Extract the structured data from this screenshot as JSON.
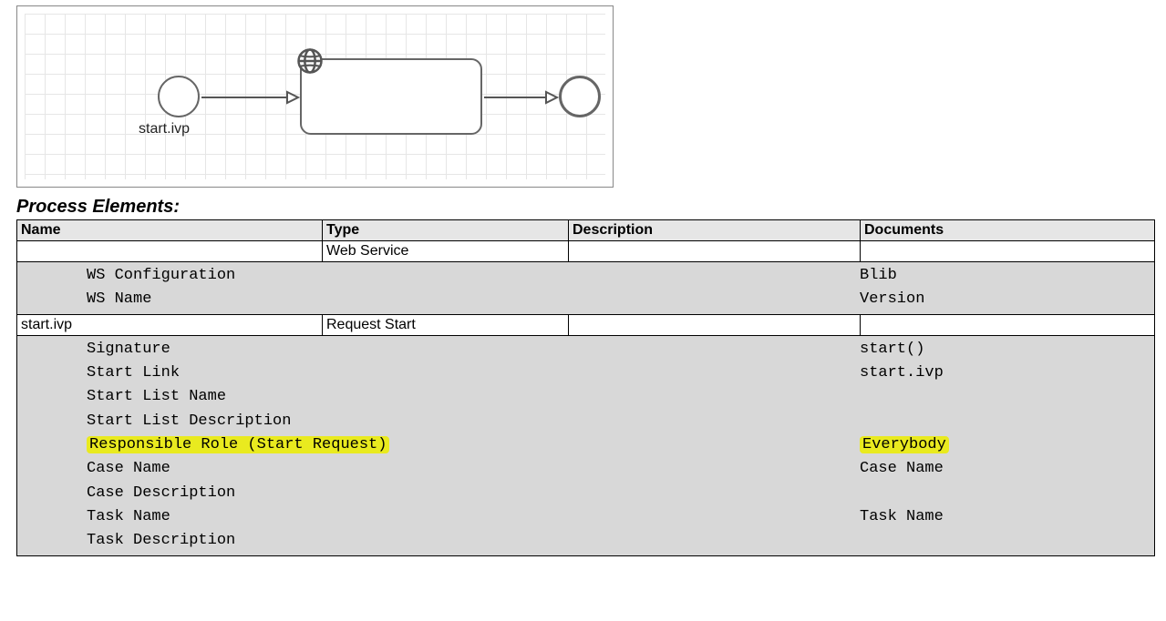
{
  "diagram": {
    "start_label": "start.ivp"
  },
  "heading": "Process Elements:",
  "table": {
    "headers": {
      "name": "Name",
      "type": "Type",
      "description": "Description",
      "documents": "Documents"
    },
    "rows": [
      {
        "name": "",
        "type": "Web Service",
        "description": "",
        "documents": "",
        "details": [
          {
            "key": "WS Configuration",
            "val": "Blib",
            "hl_key": false,
            "hl_val": false
          },
          {
            "key": "WS Name",
            "val": "Version",
            "hl_key": false,
            "hl_val": false
          }
        ]
      },
      {
        "name": "start.ivp",
        "type": "Request Start",
        "description": "",
        "documents": "",
        "details": [
          {
            "key": "Signature",
            "val": "start()",
            "hl_key": false,
            "hl_val": false
          },
          {
            "key": "Start Link",
            "val": "start.ivp",
            "hl_key": false,
            "hl_val": false
          },
          {
            "key": "Start List Name",
            "val": "",
            "hl_key": false,
            "hl_val": false
          },
          {
            "key": "Start List Description",
            "val": "",
            "hl_key": false,
            "hl_val": false
          },
          {
            "key": "Responsible Role (Start Request)",
            "val": "Everybody",
            "hl_key": true,
            "hl_val": true
          },
          {
            "key": "Case Name",
            "val": "Case Name",
            "hl_key": false,
            "hl_val": false
          },
          {
            "key": "Case Description",
            "val": "",
            "hl_key": false,
            "hl_val": false
          },
          {
            "key": "Task Name",
            "val": "Task Name",
            "hl_key": false,
            "hl_val": false
          },
          {
            "key": "Task Description",
            "val": "",
            "hl_key": false,
            "hl_val": false
          }
        ]
      }
    ]
  }
}
